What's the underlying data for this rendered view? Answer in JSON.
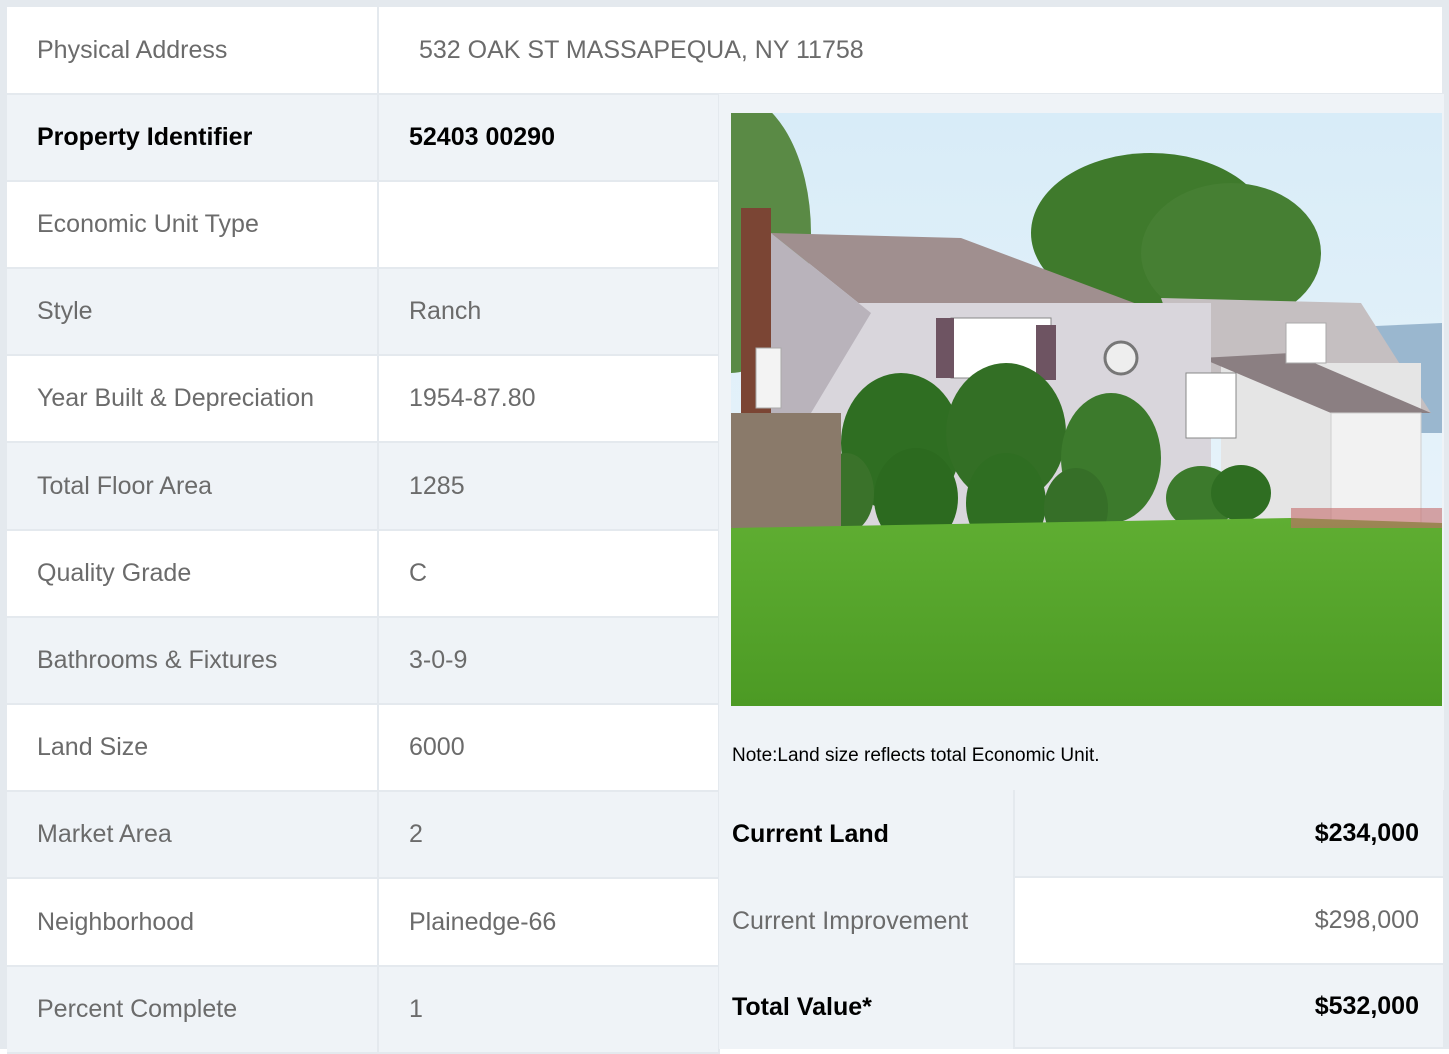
{
  "address": {
    "label": "Physical Address",
    "value": "532  OAK ST  MASSAPEQUA, NY  11758"
  },
  "rows": [
    {
      "label": "Property Identifier",
      "value": "52403  00290",
      "bold": true
    },
    {
      "label": "Economic Unit Type",
      "value": ""
    },
    {
      "label": "Style",
      "value": "Ranch"
    },
    {
      "label": "Year Built & Depreciation",
      "value": "1954-87.80"
    },
    {
      "label": "Total Floor Area",
      "value": "1285"
    },
    {
      "label": "Quality Grade",
      "value": "C"
    },
    {
      "label": "Bathrooms & Fixtures",
      "value": "3-0-9"
    },
    {
      "label": "Land Size",
      "value": "6000"
    },
    {
      "label": "Market Area",
      "value": "2"
    },
    {
      "label": "Neighborhood",
      "value": "Plainedge-66"
    },
    {
      "label": "Percent Complete",
      "value": "1"
    }
  ],
  "note": "Note:Land size reflects total Economic Unit.",
  "values": [
    {
      "label": "Current Land",
      "value": "$234,000",
      "bold": true
    },
    {
      "label": "Current Improvement",
      "value": "$298,000",
      "bold": false
    },
    {
      "label": "Total Value*",
      "value": "$532,000",
      "bold": true
    }
  ],
  "colors": {
    "row_alt": "#eff3f7",
    "border": "#e4e9ee",
    "muted_text": "#6b6b6b"
  }
}
